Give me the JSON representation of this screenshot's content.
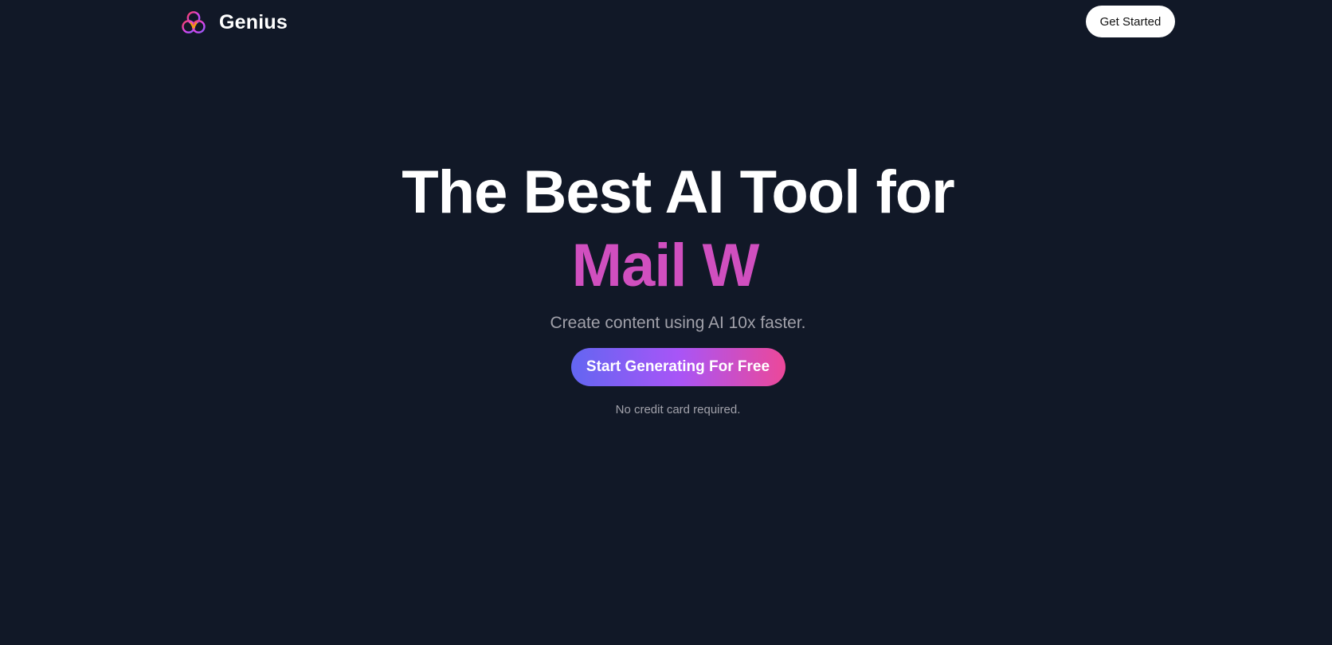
{
  "brand": {
    "name": "Genius",
    "logo_icon": "genius-logo-icon"
  },
  "nav": {
    "cta_label": "Get Started"
  },
  "hero": {
    "title_line1": "The Best AI Tool for",
    "typed_text": "Mail W",
    "subtitle": "Create content using AI 10x faster.",
    "button_label": "Start Generating For Free",
    "note": "No credit card required."
  },
  "colors": {
    "background": "#111827",
    "typed_text": "#d04fbf",
    "button_gradient_start": "#6366f1",
    "button_gradient_mid": "#a855f7",
    "button_gradient_end": "#ec4899",
    "muted_text": "#a1a1aa"
  }
}
